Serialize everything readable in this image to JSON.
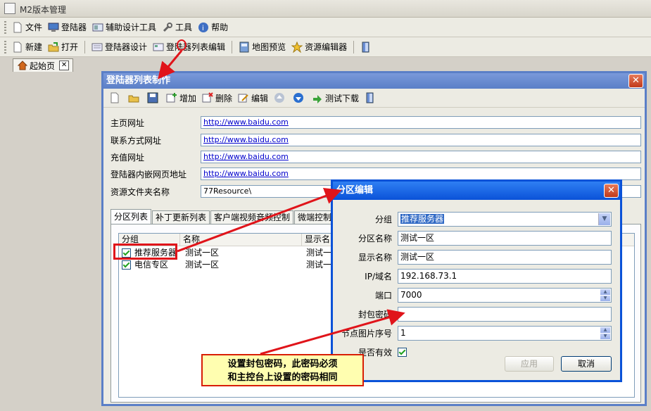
{
  "app": {
    "title": "M2版本管理"
  },
  "menu": [
    {
      "label": "文件",
      "icon": "file-icon"
    },
    {
      "label": "登陆器",
      "icon": "monitor-icon"
    },
    {
      "label": "辅助设计工具",
      "icon": "design-tool-icon"
    },
    {
      "label": "工具",
      "icon": "wrench-icon"
    },
    {
      "label": "帮助",
      "icon": "help-icon"
    }
  ],
  "toolbar": [
    {
      "label": "新建",
      "icon": "new-file-icon"
    },
    {
      "label": "打开",
      "icon": "open-folder-icon"
    },
    {
      "label": "登陆器设计",
      "icon": "design-icon"
    },
    {
      "label": "登陆器列表编辑",
      "icon": "list-edit-icon"
    },
    {
      "label": "地图预览",
      "icon": "map-icon"
    },
    {
      "label": "资源编辑器",
      "icon": "resource-icon"
    }
  ],
  "doc_tab": {
    "label": "起始页",
    "close": "✕"
  },
  "main_dialog": {
    "title": "登陆器列表制作",
    "close": "✕",
    "toolbar": {
      "add": "增加",
      "delete": "删除",
      "edit": "编辑",
      "test_download": "测试下载"
    },
    "fields": [
      {
        "label": "主页网址",
        "value": "http://www.baidu.com",
        "link": true
      },
      {
        "label": "联系方式网址",
        "value": "http://www.baidu.com",
        "link": true
      },
      {
        "label": "充值网址",
        "value": "http://www.baidu.com",
        "link": true
      },
      {
        "label": "登陆器内嵌网页地址",
        "value": "http://www.baidu.com",
        "link": true
      },
      {
        "label": "资源文件夹名称",
        "value": "77Resource\\",
        "link": false
      }
    ],
    "tabs": [
      "分区列表",
      "补丁更新列表",
      "客户端视频音频控制",
      "微端控制"
    ],
    "list": {
      "columns": [
        "分组",
        "名称",
        "显示名"
      ],
      "rows": [
        {
          "group": "推荐服务器",
          "name": "测试一区",
          "display": "测试一"
        },
        {
          "group": "电信专区",
          "name": "测试一区",
          "display": "测试一"
        }
      ]
    }
  },
  "partition_dialog": {
    "title": "分区编辑",
    "close": "✕",
    "fields": {
      "group": {
        "label": "分组",
        "value": "推荐服务器"
      },
      "partition_name": {
        "label": "分区名称",
        "value": "测试一区"
      },
      "display_name": {
        "label": "显示名称",
        "value": "测试一区"
      },
      "ip": {
        "label": "IP/域名",
        "value": "192.168.73.1"
      },
      "port": {
        "label": "端口",
        "value": "7000"
      },
      "password": {
        "label": "封包密码",
        "value": ""
      },
      "node_image": {
        "label": "节点图片序号",
        "value": "1"
      },
      "enabled": {
        "label": "是否有效",
        "checked": true
      }
    },
    "buttons": {
      "apply": "应用",
      "cancel": "取消"
    }
  },
  "annotation": {
    "line1": "设置封包密码，此密码必须",
    "line2": "和主控台上设置的密码相同"
  },
  "colors": {
    "annotation_border": "#d81e05",
    "annotation_bg": "#fffeb0",
    "arrow": "#e0141a"
  }
}
